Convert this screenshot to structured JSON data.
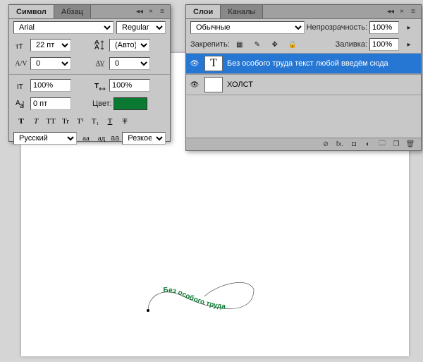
{
  "characterPanel": {
    "tabs": {
      "character": "Символ",
      "paragraph": "Абзац"
    },
    "font": "Arial",
    "fontStyle": "Regular",
    "fontSize": "22 пт",
    "leading": "(Авто)",
    "kerning": "0",
    "tracking": "0",
    "vscale": "100%",
    "hscale": "100%",
    "baseline": "0 пт",
    "colorLabel": "Цвет:",
    "color": "#0a7a32",
    "language": "Русский",
    "aaLabel": "aa",
    "antiAlias": "Резкое",
    "styleBtns": [
      "T",
      "T",
      "TT",
      "Tr",
      "T¹",
      "T₁",
      "T",
      "Ŧ"
    ],
    "langBtns": [
      "аа",
      "ад"
    ]
  },
  "layersPanel": {
    "tabs": {
      "layers": "Слои",
      "channels": "Каналы"
    },
    "blendMode": "Обычные",
    "opacityLabel": "Непрозрачность:",
    "opacityValue": "100%",
    "lockLabel": "Закрепить:",
    "fillLabel": "Заливка:",
    "fillValue": "100%",
    "layer1Name": "Без особого труда текст любой введём сюда",
    "layer1Thumb": "T",
    "layer2Name": "ХОЛСТ"
  },
  "canvas": {
    "textOnPath": "Без особого труда"
  }
}
